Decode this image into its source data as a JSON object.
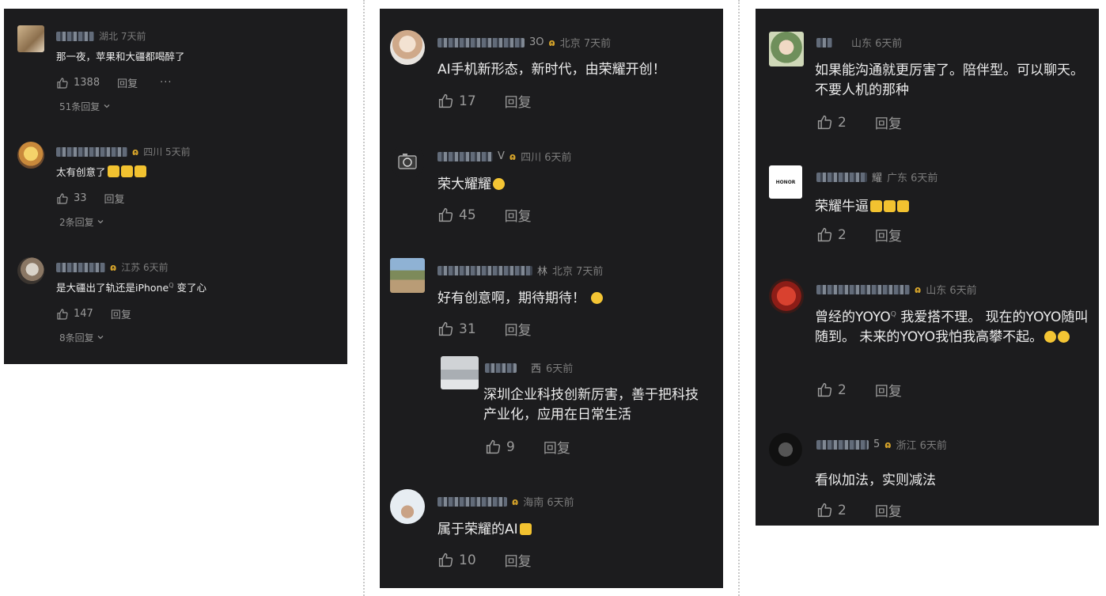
{
  "panels": [
    {
      "comments": [
        {
          "location": "湖北 7天前",
          "text": "那一夜，苹果和大疆都喝醉了",
          "likes": "1388",
          "reply": "回复",
          "more": "···",
          "replies": "51条回复"
        },
        {
          "location": "四川 5天前",
          "text": "太有创意了",
          "likes": "33",
          "reply": "回复",
          "replies": "2条回复"
        },
        {
          "location": "江苏 6天前",
          "text": "是大疆出了轨还是iPhone",
          "text_b": "变了心",
          "likes": "147",
          "reply": "回复",
          "replies": "8条回复"
        }
      ]
    },
    {
      "comments": [
        {
          "name_fragment": "3O",
          "location": "北京 7天前",
          "text": "AI手机新形态，新时代，由荣耀开创！",
          "likes": "17",
          "reply": "回复"
        },
        {
          "name_fragment": "V",
          "location": "四川 6天前",
          "text": "荣大耀耀",
          "likes": "45",
          "reply": "回复"
        },
        {
          "name_fragment": "林",
          "location": "北京 7天前",
          "text": "好有创意啊，期待期待！",
          "likes": "31",
          "reply": "回复"
        },
        {
          "name_fragment": "西",
          "location": "6天前",
          "text": "深圳企业科技创新厉害，善于把科技产业化，应用在日常生活",
          "likes": "9",
          "reply": "回复"
        },
        {
          "location": "海南 6天前",
          "text": "属于荣耀的AI",
          "likes": "10",
          "reply": "回复"
        }
      ]
    },
    {
      "comments": [
        {
          "location": "山东 6天前",
          "text": "如果能沟通就更厉害了。陪伴型。可以聊天。不要人机的那种",
          "likes": "2",
          "reply": "回复"
        },
        {
          "name_fragment": "耀",
          "location": "广东 6天前",
          "avatar_text": "HONOR",
          "text": "荣耀牛逼",
          "likes": "2",
          "reply": "回复"
        },
        {
          "location": "山东 6天前",
          "text": "曾经的YOYO",
          "text_b": "我爱搭不理。 现在的YOYO随叫随到。 未来的YOYO我怕我高攀不起。",
          "likes": "2",
          "reply": "回复"
        },
        {
          "name_fragment": "5",
          "location": "浙江 6天前",
          "text": "看似加法，实则减法",
          "likes": "2",
          "reply": "回复"
        }
      ]
    }
  ],
  "colors": {
    "panel_bg": "#1c1c1e",
    "badge": "#d9a62b",
    "meta": "#7b7b7b"
  },
  "icons": [
    "thumbs-up-icon",
    "chevron-down-icon",
    "search-superscript-icon",
    "thumbs-emoji",
    "smile-emoji",
    "grin-emoji"
  ]
}
